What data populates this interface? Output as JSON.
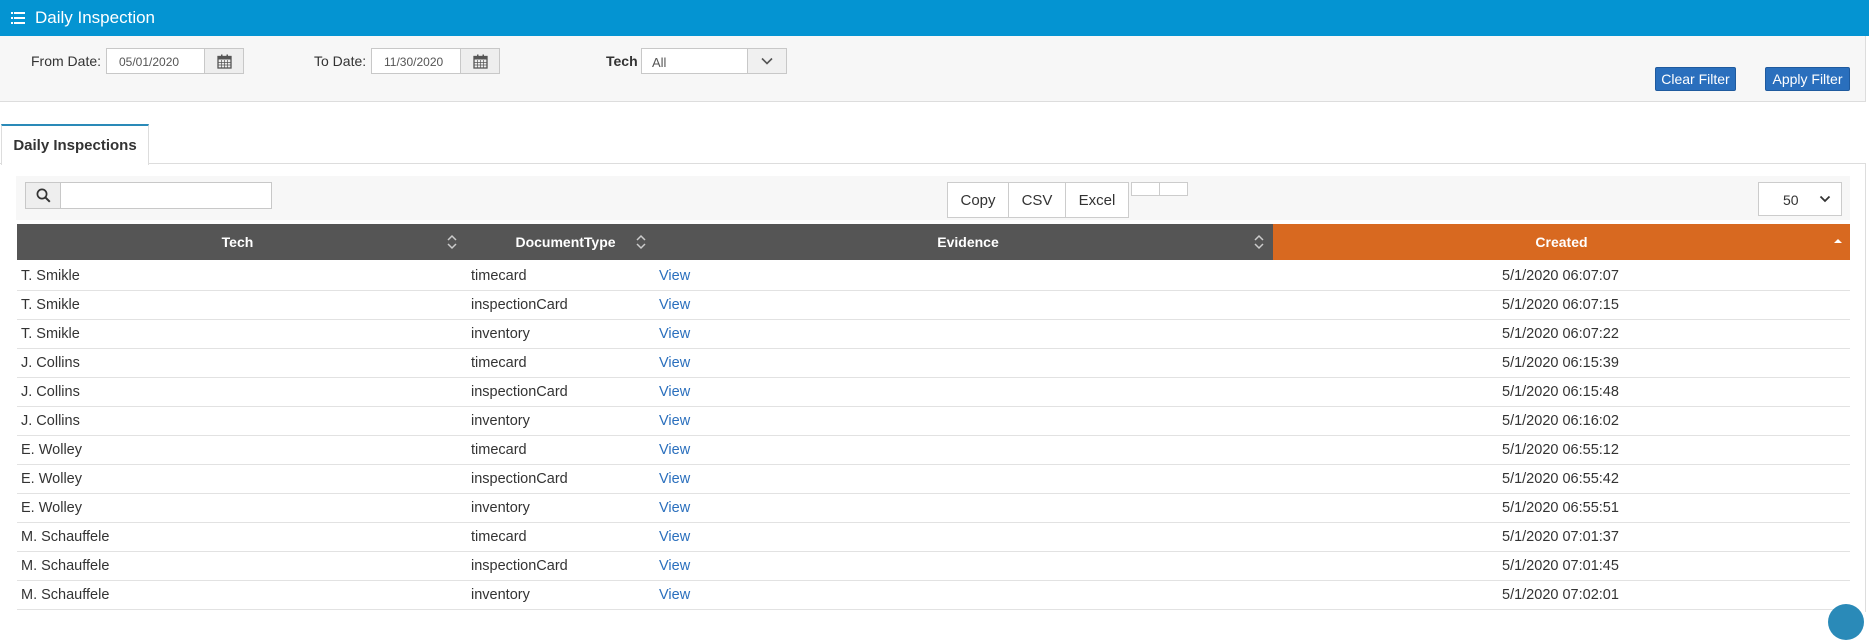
{
  "header": {
    "title": "Daily Inspection",
    "icon": "list-icon"
  },
  "filters": {
    "from_label": "From Date:",
    "from_value": "05/01/2020",
    "to_label": "To Date:",
    "to_value": "11/30/2020",
    "tech_label": "Tech",
    "tech_value": "All",
    "clear_label": "Clear Filter",
    "apply_label": "Apply Filter"
  },
  "tabs": [
    {
      "label": "Daily Inspections",
      "active": true
    }
  ],
  "toolbar": {
    "search_value": "",
    "export_buttons": [
      "Copy",
      "CSV",
      "Excel"
    ],
    "page_length": "50"
  },
  "table": {
    "columns": [
      "Tech",
      "DocumentType",
      "Evidence",
      "Created"
    ],
    "sorted_column": "Created",
    "rows": [
      {
        "tech": "T. Smikle",
        "doc": "timecard",
        "evidence": "View",
        "created": "5/1/2020 06:07:07"
      },
      {
        "tech": "T. Smikle",
        "doc": "inspectionCard",
        "evidence": "View",
        "created": "5/1/2020 06:07:15"
      },
      {
        "tech": "T. Smikle",
        "doc": "inventory",
        "evidence": "View",
        "created": "5/1/2020 06:07:22"
      },
      {
        "tech": "J. Collins",
        "doc": "timecard",
        "evidence": "View",
        "created": "5/1/2020 06:15:39"
      },
      {
        "tech": "J. Collins",
        "doc": "inspectionCard",
        "evidence": "View",
        "created": "5/1/2020 06:15:48"
      },
      {
        "tech": "J. Collins",
        "doc": "inventory",
        "evidence": "View",
        "created": "5/1/2020 06:16:02"
      },
      {
        "tech": "E. Wolley",
        "doc": "timecard",
        "evidence": "View",
        "created": "5/1/2020 06:55:12"
      },
      {
        "tech": "E. Wolley",
        "doc": "inspectionCard",
        "evidence": "View",
        "created": "5/1/2020 06:55:42"
      },
      {
        "tech": "E. Wolley",
        "doc": "inventory",
        "evidence": "View",
        "created": "5/1/2020 06:55:51"
      },
      {
        "tech": "M. Schauffele",
        "doc": "timecard",
        "evidence": "View",
        "created": "5/1/2020 07:01:37"
      },
      {
        "tech": "M. Schauffele",
        "doc": "inspectionCard",
        "evidence": "View",
        "created": "5/1/2020 07:01:45"
      },
      {
        "tech": "M. Schauffele",
        "doc": "inventory",
        "evidence": "View",
        "created": "5/1/2020 07:02:01"
      }
    ]
  },
  "colors": {
    "header": "#0494d2",
    "accent_button": "#2a6fbd",
    "table_head": "#555555",
    "sorted_head": "#d86920",
    "link": "#2a6fbd"
  }
}
